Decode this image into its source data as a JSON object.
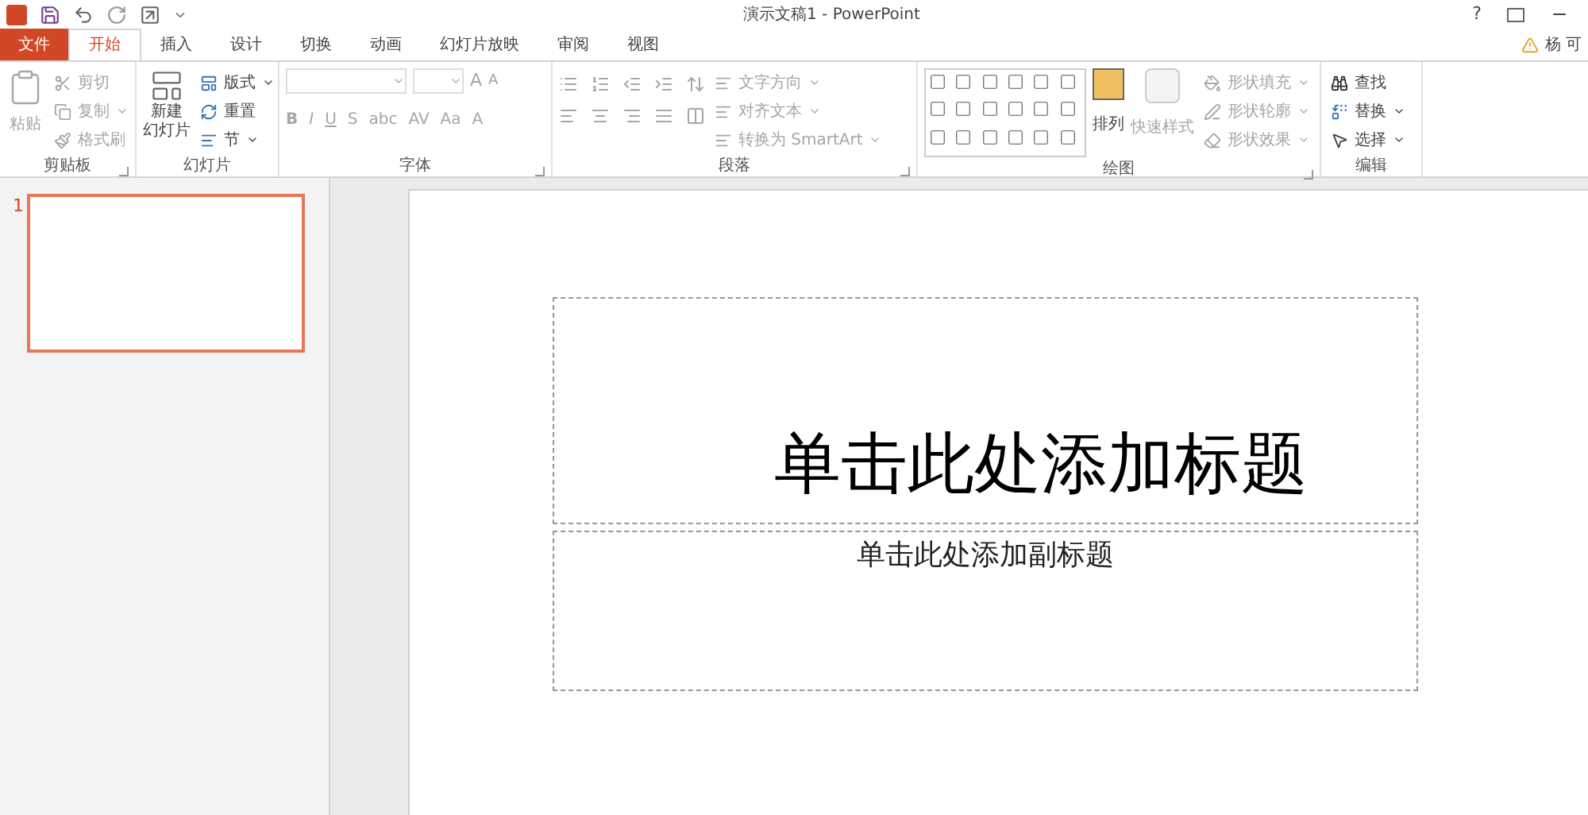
{
  "window": {
    "title": "演示文稿1 - PowerPoint",
    "user": "杨 可",
    "help": "?"
  },
  "tabs": [
    {
      "label": "文件",
      "kind": "file",
      "selected": false
    },
    {
      "label": "开始",
      "kind": "tab",
      "selected": true
    },
    {
      "label": "插入",
      "kind": "tab",
      "selected": false
    },
    {
      "label": "设计",
      "kind": "tab",
      "selected": false
    },
    {
      "label": "切换",
      "kind": "tab",
      "selected": false
    },
    {
      "label": "动画",
      "kind": "tab",
      "selected": false
    },
    {
      "label": "幻灯片放映",
      "kind": "tab",
      "selected": false
    },
    {
      "label": "审阅",
      "kind": "tab",
      "selected": false
    },
    {
      "label": "视图",
      "kind": "tab",
      "selected": false
    }
  ],
  "clipboard": {
    "label": "剪贴板",
    "paste": {
      "label": "粘贴",
      "disabled": true
    },
    "items": [
      {
        "label": "剪切",
        "disabled": true
      },
      {
        "label": "复制",
        "disabled": true
      },
      {
        "label": "格式刷",
        "disabled": true
      }
    ]
  },
  "slides_group": {
    "label": "幻灯片",
    "new_slide": [
      "新建",
      "幻灯片"
    ],
    "items": [
      {
        "label": "版式",
        "disabled": false
      },
      {
        "label": "重置",
        "disabled": false
      },
      {
        "label": "节",
        "disabled": false
      }
    ]
  },
  "font": {
    "label": "字体",
    "format_buttons": [
      {
        "text": "B",
        "disabled": true
      },
      {
        "text": "I",
        "disabled": true
      },
      {
        "text": "U",
        "disabled": true
      },
      {
        "text": "S",
        "disabled": true
      },
      {
        "text": "abc",
        "disabled": true
      },
      {
        "text": "AV",
        "disabled": true
      },
      {
        "text": "Aa",
        "disabled": true
      },
      {
        "text": "A",
        "disabled": true
      }
    ],
    "grow": "A",
    "shrink": "A"
  },
  "paragraph": {
    "label": "段落",
    "items": [
      {
        "label": "文字方向",
        "disabled": true
      },
      {
        "label": "对齐文本",
        "disabled": true
      },
      {
        "label": "转换为 SmartArt",
        "disabled": true
      }
    ]
  },
  "drawing": {
    "label": "绘图",
    "arrange": "排列",
    "quick_styles": {
      "label": "快速样式",
      "disabled": true
    },
    "items": [
      {
        "label": "形状填充",
        "disabled": true
      },
      {
        "label": "形状轮廓",
        "disabled": true
      },
      {
        "label": "形状效果",
        "disabled": true
      }
    ]
  },
  "editing": {
    "label": "编辑",
    "items": [
      {
        "label": "查找",
        "kind": "find"
      },
      {
        "label": "替换",
        "kind": "replace"
      },
      {
        "label": "选择",
        "kind": "select"
      }
    ]
  },
  "thumbnails": [
    {
      "number": "1",
      "selected": true
    }
  ],
  "slide": {
    "title_placeholder": "单击此处添加标题",
    "subtitle_placeholder": "单击此处添加副标题"
  }
}
